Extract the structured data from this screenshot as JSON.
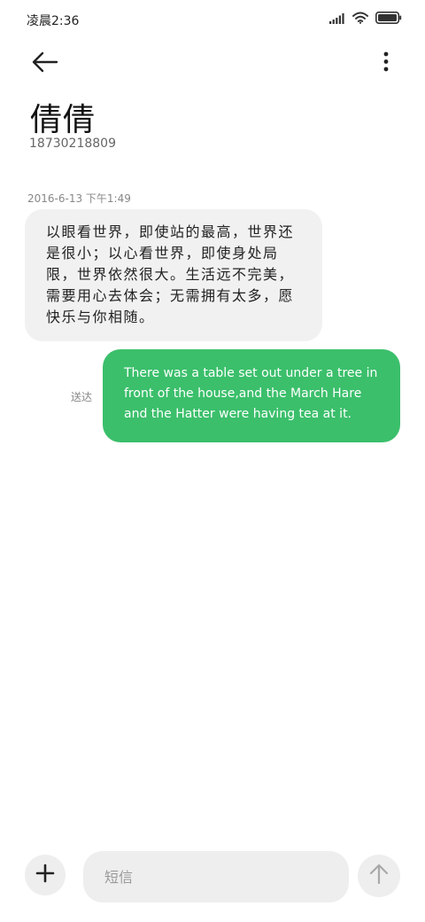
{
  "status_bar": {
    "time": "凌晨2:36",
    "icons": [
      "signal-icon",
      "wifi-icon",
      "battery-icon"
    ]
  },
  "nav": {
    "icons": [
      "back-arrow-icon",
      "more-vert-icon"
    ]
  },
  "contact": {
    "name": "倩倩",
    "number": "18730218809"
  },
  "conversation": {
    "timestamp": "2016-6-13 下午1:49",
    "incoming_message": "以眼看世界，即使站的最高，世界还是很小；以心看世界，即使身处局限，世界依然很大。生活远不完美，需要用心去体会；无需拥有太多，愿快乐与你相随。",
    "outgoing_message": "There was a table set out under a tree in front of the house,and the March Hare and the Hatter were having tea at it.",
    "outgoing_status": "送达"
  },
  "composer": {
    "placeholder": "短信",
    "icons": [
      "plus-icon",
      "send-arrow-icon"
    ]
  },
  "colors": {
    "outgoing_bubble": "#3bbf6b",
    "incoming_bubble": "#f1f1f1",
    "input_background": "#eeeeee"
  }
}
